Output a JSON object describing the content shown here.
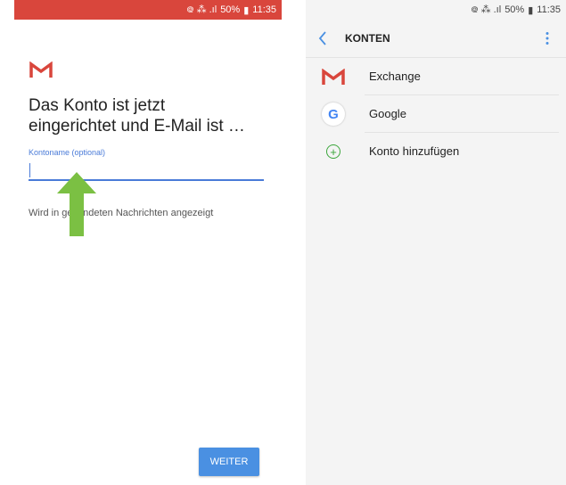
{
  "left": {
    "status": {
      "signal": "᪤ ⁂ .ıl",
      "battery": "50%",
      "time": "11:35"
    },
    "title": "Das Konto ist jetzt\neingerichtet und E-Mail ist …",
    "field_label": "Kontoname (optional)",
    "field_value": "",
    "helper": "Wird in gesendeten Nachrichten angezeigt",
    "weiter": "WEITER"
  },
  "right": {
    "status": {
      "signal": "᪤ ⁂ .ıl",
      "battery": "50%",
      "time": "11:35"
    },
    "header_title": "KONTEN",
    "accounts": [
      {
        "label": "Exchange",
        "icon": "gmail-icon"
      },
      {
        "label": "Google",
        "icon": "google-icon"
      },
      {
        "label": "Konto hinzufügen",
        "icon": "add-icon"
      }
    ]
  },
  "colors": {
    "accent": "#4a90e2",
    "statusbar": "#d9463c",
    "arrow": "#7bc043",
    "add": "#3aa53a"
  }
}
